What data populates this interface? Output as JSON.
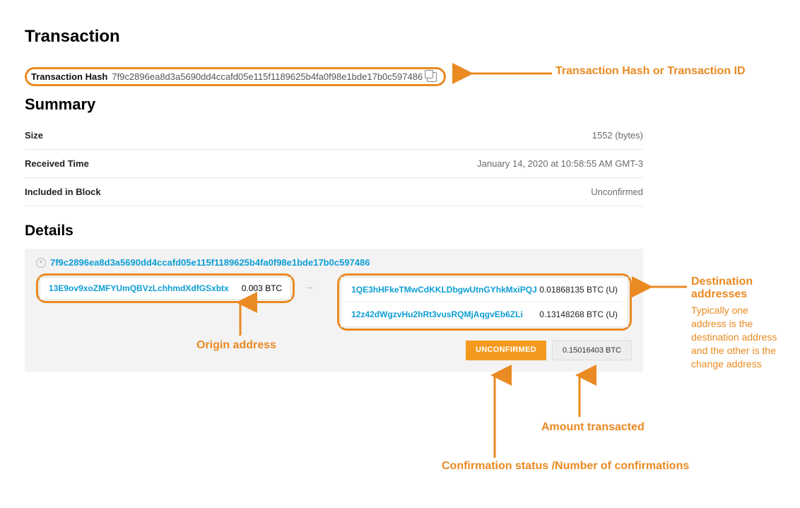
{
  "page_title": "Transaction",
  "hash": {
    "label": "Transaction Hash",
    "value": "7f9c2896ea8d3a5690dd4ccafd05e115f1189625b4fa0f98e1bde17b0c597486"
  },
  "summary": {
    "title": "Summary",
    "rows": [
      {
        "label": "Size",
        "value": "1552 (bytes)"
      },
      {
        "label": "Received Time",
        "value": "January 14, 2020 at 10:58:55 AM GMT-3"
      },
      {
        "label": "Included in Block",
        "value": "Unconfirmed"
      }
    ]
  },
  "details": {
    "title": "Details",
    "tx_link": "7f9c2896ea8d3a5690dd4ccafd05e115f1189625b4fa0f98e1bde17b0c597486",
    "origin": {
      "address": "13E9ov9xoZMFYUmQBVzLchhmdXdfGSxbtx",
      "amount": "0.003 BTC"
    },
    "destinations": [
      {
        "address": "1QE3hHFkeTMwCdKKLDbgwUtnGYhkMxiPQJ",
        "amount": "0.01868135 BTC (U)"
      },
      {
        "address": "12z42dWgzvHu2hRt3vusRQMjAqgvEb6ZLi",
        "amount": "0.13148268 BTC (U)"
      }
    ],
    "status_badge": "UNCONFIRMED",
    "total_badge": "0.15016403 BTC"
  },
  "annotations": {
    "hash": "Transaction Hash or Transaction ID",
    "origin": "Origin address",
    "dest_title": "Destination addresses",
    "dest_sub": "Typically one address is the destination address and the other is the change address",
    "status": "Confirmation status /Number of confirmations",
    "amount": "Amount transacted"
  }
}
